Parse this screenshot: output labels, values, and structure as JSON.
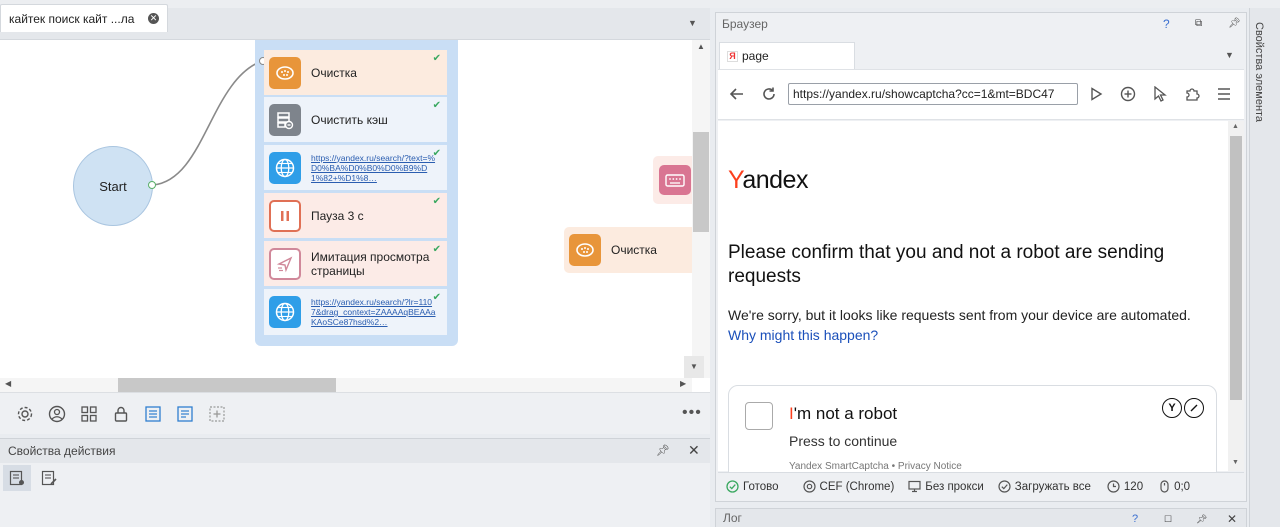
{
  "project": {
    "tab_label": "кайтек поиск кайт ...ла",
    "tab_close_icon": "close-icon"
  },
  "canvas": {
    "start_label": "Start",
    "actions": [
      {
        "label": "Очистка",
        "icon": "cleanup-icon",
        "kind": "text"
      },
      {
        "label": "Очистить кэш",
        "icon": "clear-cache-icon",
        "kind": "text"
      },
      {
        "label": "https://yandex.ru/search/?text=%D0%BA%D0%B0%D0%B9%D1%82+%D1%8…",
        "icon": "globe-icon",
        "kind": "link"
      },
      {
        "label": "Пауза 3 с",
        "icon": "pause-icon",
        "kind": "text"
      },
      {
        "label": "Имитация просмотра страницы",
        "icon": "page-view-icon",
        "kind": "text"
      },
      {
        "label": "https://yandex.ru/search/?lr=1107&drag_context=ZAAAAqBEAAaKAoSCe87hsd%2…",
        "icon": "globe-icon",
        "kind": "link"
      }
    ],
    "outside_node_label": "Очистка"
  },
  "action_properties": {
    "title": "Свойства действия"
  },
  "browser": {
    "panel_title": "Браузер",
    "help": "?",
    "tab_label": "page",
    "url": "https://yandex.ru/showcaptcha?cc=1&mt=BDC47",
    "page": {
      "logo_first": "Y",
      "logo_rest": "andex",
      "title": "Please confirm that you and not a robot are sending requests",
      "description": "We're sorry, but it looks like requests sent from your device are automated.",
      "why_link": "Why might this happen?",
      "checkbox_i": "I",
      "checkbox_rest": "'m not a robot",
      "press_continue": "Press to continue",
      "smartcaptcha": "Yandex SmartCaptcha • Privacy Notice"
    },
    "status": {
      "ready": "Готово",
      "engine": "CEF (Chrome)",
      "proxy": "Без прокси",
      "load": "Загружать все",
      "timeout": "120",
      "coords": "0;0"
    }
  },
  "log": {
    "title": "Лог",
    "help": "?"
  },
  "side": {
    "label": "Свойства элемента"
  },
  "colors": {
    "accent_blue": "#2f9ee8",
    "group_bg": "#c9def5",
    "yandex_red": "#fc3f1d",
    "ok_green": "#3aa860"
  }
}
